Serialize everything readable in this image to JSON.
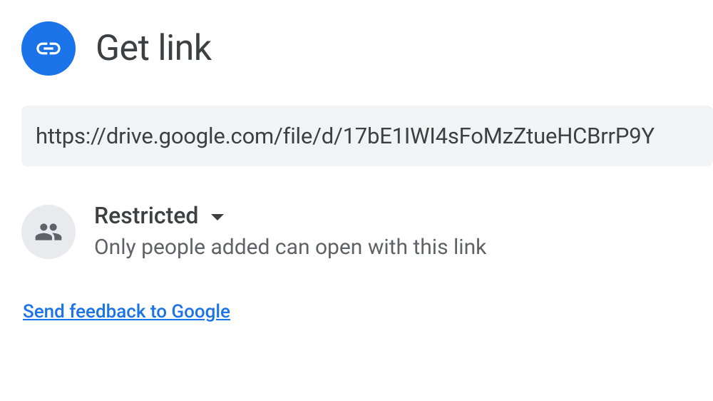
{
  "header": {
    "title": "Get link"
  },
  "link": {
    "url": "https://drive.google.com/file/d/17bE1IWI4sFoMzZtueHCBrrP9Y"
  },
  "permission": {
    "mode": "Restricted",
    "description": "Only people added can open with this link"
  },
  "feedback": {
    "label": "Send feedback to Google"
  },
  "colors": {
    "accent": "#1a73e8",
    "icon_bg": "#e8eaed",
    "url_bg": "#f1f3f4",
    "text_primary": "#3c4043",
    "text_secondary": "#5f6368"
  }
}
